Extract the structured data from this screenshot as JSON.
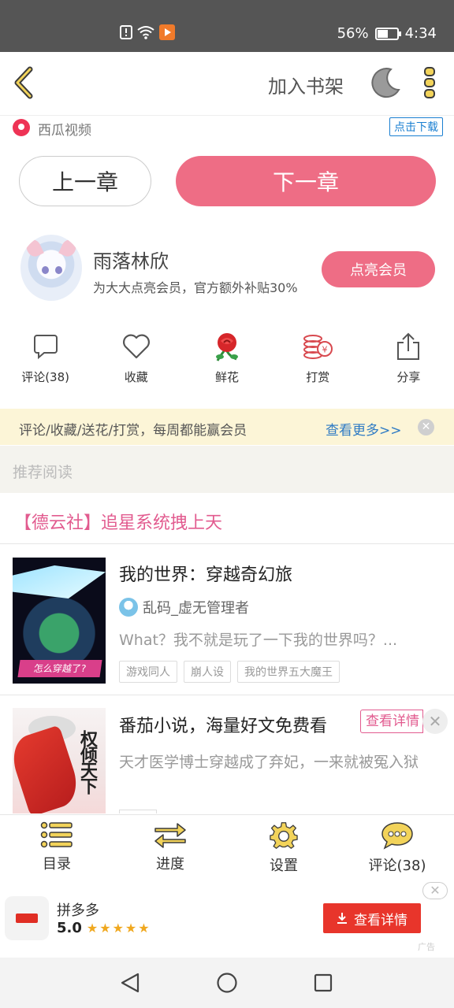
{
  "status_bar": {
    "battery": "56%",
    "time": "4:34",
    "battery_level": 0.56
  },
  "top_bar": {
    "add_to_shelf": "加入书架"
  },
  "xigua_ad": {
    "name": "西瓜视频",
    "download": "点击下载"
  },
  "chapter_nav": {
    "prev": "上一章",
    "next": "下一章"
  },
  "member": {
    "username": "雨落林欣",
    "description": "为大大点亮会员，官方额外补贴30%",
    "button": "点亮会员"
  },
  "actions": [
    {
      "label": "评论(38)",
      "icon": "comment-icon"
    },
    {
      "label": "收藏",
      "icon": "heart-icon"
    },
    {
      "label": "鲜花",
      "icon": "rose-icon"
    },
    {
      "label": "打赏",
      "icon": "coins-icon"
    },
    {
      "label": "分享",
      "icon": "share-icon"
    }
  ],
  "notice": {
    "text": "评论/收藏/送花/打赏，每周都能赢会员",
    "more": "查看更多>>"
  },
  "recommend": {
    "header": "推荐阅读",
    "feature": "【德云社】追星系统拽上天"
  },
  "books": [
    {
      "title": "我的世界：穿越奇幻旅",
      "author": "乱码_虚无管理者",
      "summary": "What？我不就是玩了一下我的世界吗？...",
      "tags": [
        "游戏同人",
        "崩人设",
        "我的世界五大魔王"
      ],
      "cover_banner": "怎么穿越了?"
    },
    {
      "title": "番茄小说，海量好文免费看",
      "summary": "天才医学博士穿越成了弃妃，一来就被冤入狱",
      "detail_button": "查看详情",
      "cover_title": "权倾天下"
    }
  ],
  "toolbar": [
    {
      "label": "目录",
      "icon": "list-icon"
    },
    {
      "label": "进度",
      "icon": "progress-arrows-icon"
    },
    {
      "label": "设置",
      "icon": "gear-icon"
    },
    {
      "label": "评论(38)",
      "icon": "chat-bubble-icon"
    }
  ],
  "bottom_ad": {
    "app": "拼多多",
    "rating": "5.0",
    "stars": "★★★★★",
    "button": "查看详情",
    "tag": "广告"
  },
  "colors": {
    "accent_pink": "#ee6d85",
    "link_blue": "#2f7bc4",
    "notice_bg": "#fcf5d7",
    "ad_red": "#e8352b"
  }
}
